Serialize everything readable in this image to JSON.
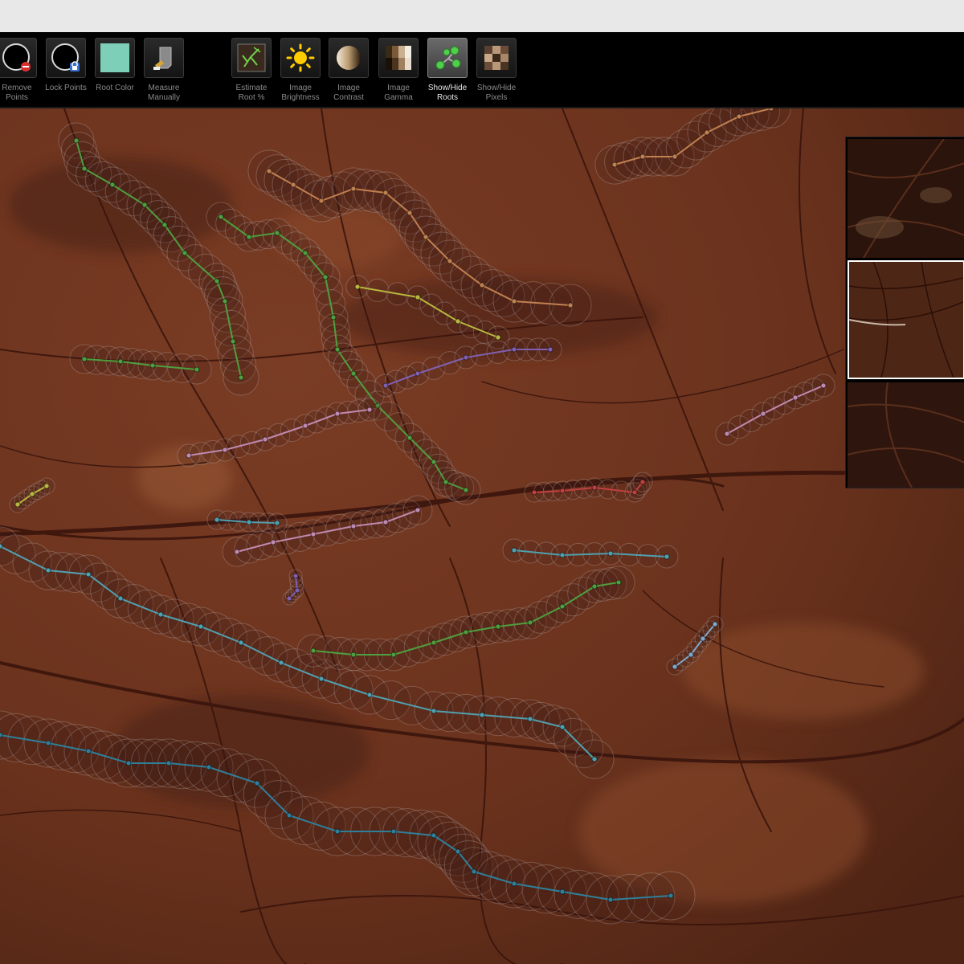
{
  "toolbar": {
    "tools": [
      {
        "label": "Remove\nPoints",
        "icon": "remove-points-icon",
        "active": false
      },
      {
        "label": "Lock Points",
        "icon": "lock-points-icon",
        "active": false
      },
      {
        "label": "Root Color",
        "icon": "root-color-swatch",
        "active": false,
        "swatch_color": "#7ecfb8"
      },
      {
        "label": "Measure\nManually",
        "icon": "measure-manually-icon",
        "active": false
      },
      {
        "label": "Estimate\nRoot %",
        "icon": "estimate-root-icon",
        "active": false
      },
      {
        "label": "Image\nBrightness",
        "icon": "sun-icon",
        "active": false
      },
      {
        "label": "Image\nContrast",
        "icon": "contrast-icon",
        "active": false
      },
      {
        "label": "Image\nGamma",
        "icon": "gamma-icon",
        "active": false
      },
      {
        "label": "Show/Hide\nRoots",
        "icon": "show-hide-roots-icon",
        "active": true
      },
      {
        "label": "Show/Hide\nPixels",
        "icon": "show-hide-pixels-icon",
        "active": false
      }
    ]
  },
  "viewer": {
    "background_color": "#6e3520",
    "root_colors": [
      "#4f9e3f",
      "#c08050",
      "#b8b840",
      "#8060b0",
      "#c08ab0",
      "#50a0b0",
      "#c04040",
      "#7fa8c8",
      "#2f7f9a"
    ]
  },
  "thumbnails": {
    "count": 3,
    "selected_index": 1
  }
}
